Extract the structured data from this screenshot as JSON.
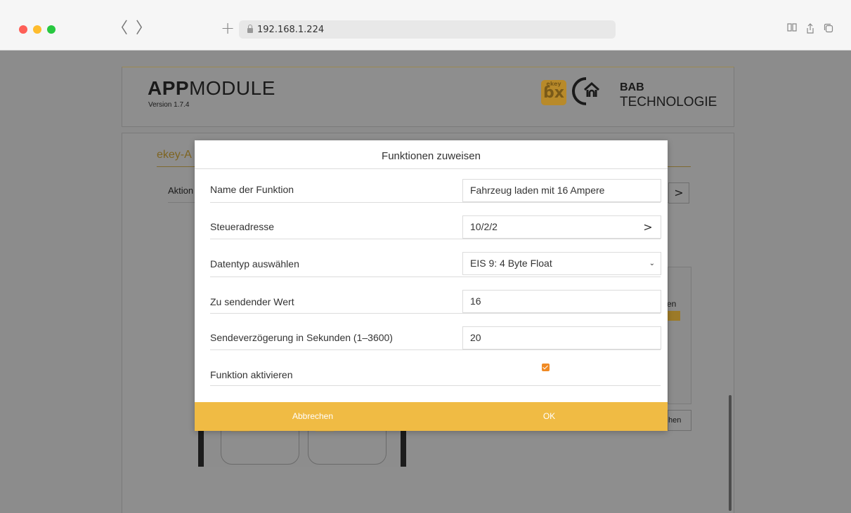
{
  "browser": {
    "url": "192.168.1.224",
    "back_glyph": "〈",
    "forward_glyph": "〉",
    "new_tab_glyph": "+",
    "reader_glyph": "📖",
    "share_glyph": "⇧",
    "tabs_glyph": "⧉"
  },
  "app": {
    "title_bold": "APP",
    "title_regular": "MODULE",
    "version": "Version 1.7.4",
    "ekey_text": "ekey",
    "ekey_mark": "ɓx",
    "brand_name": "BAB",
    "brand_sub": "TECHNOLOGIE"
  },
  "background": {
    "section_title": "ekey-A",
    "row_label": "Aktion",
    "chevron": ">",
    "box_text": "en",
    "bottom_btn": "hen"
  },
  "modal": {
    "title": "Funktionen zuweisen",
    "fields": {
      "name": {
        "label": "Name der Funktion",
        "value": "Fahrzeug laden mit 16 Ampere"
      },
      "address": {
        "label": "Steueradresse",
        "value": "10/2/2",
        "chevron": ">"
      },
      "datatype": {
        "label": "Datentyp auswählen",
        "value": "EIS 9: 4 Byte Float",
        "caret": "⌄"
      },
      "send_value": {
        "label": "Zu sendender Wert",
        "value": "16"
      },
      "delay": {
        "label": "Sendeverzögerung in Sekunden (1–3600)",
        "value": "20"
      },
      "activate": {
        "label": "Funktion aktivieren",
        "checked": true
      }
    },
    "cancel_label": "Abbrechen",
    "ok_label": "OK"
  },
  "colors": {
    "accent": "#f0bb44",
    "checkbox": "#f08a24"
  }
}
